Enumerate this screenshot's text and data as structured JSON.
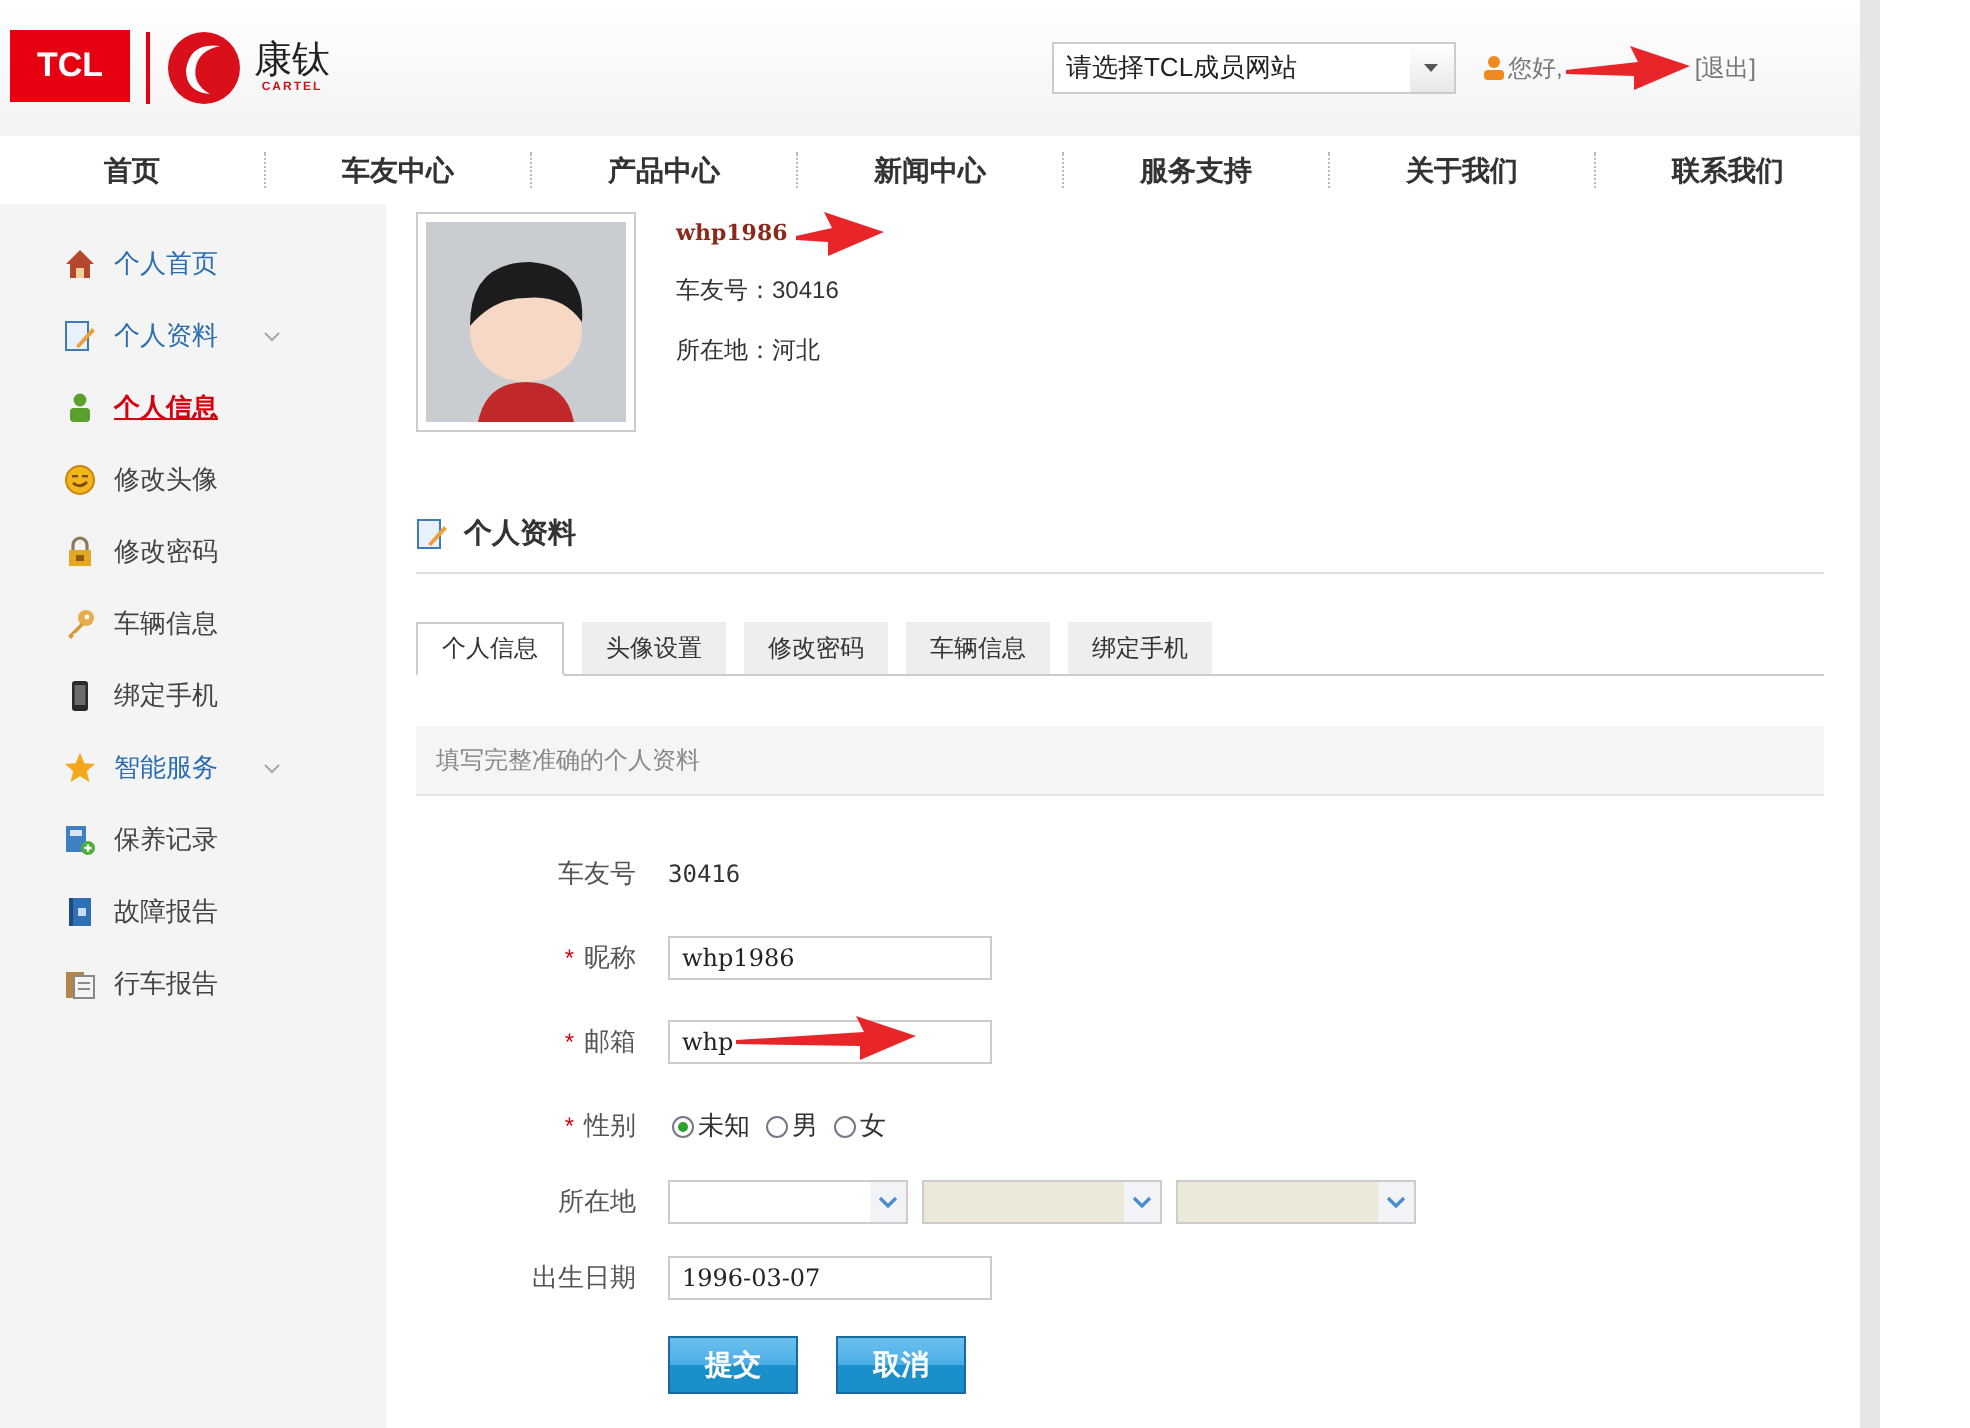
{
  "header": {
    "logo_tcl": "TCL",
    "logo_brand": "康钛",
    "logo_brand_sub": "CARTEL",
    "site_select": {
      "value": "请选择TCL成员网站"
    },
    "greeting": "您好,",
    "logout": "[退出]"
  },
  "nav": [
    "首页",
    "车友中心",
    "产品中心",
    "新闻中心",
    "服务支持",
    "关于我们",
    "联系我们"
  ],
  "sidebar": {
    "items": [
      {
        "label": "个人首页",
        "kind": "link",
        "selected": false
      },
      {
        "label": "个人资料",
        "kind": "group",
        "selected": false
      },
      {
        "label": "个人信息",
        "kind": "item",
        "selected": true
      },
      {
        "label": "修改头像",
        "kind": "item",
        "selected": false
      },
      {
        "label": "修改密码",
        "kind": "item",
        "selected": false
      },
      {
        "label": "车辆信息",
        "kind": "item",
        "selected": false
      },
      {
        "label": "绑定手机",
        "kind": "item",
        "selected": false
      },
      {
        "label": "智能服务",
        "kind": "group",
        "selected": false
      },
      {
        "label": "保养记录",
        "kind": "item",
        "selected": false
      },
      {
        "label": "故障报告",
        "kind": "item",
        "selected": false
      },
      {
        "label": "行车报告",
        "kind": "item",
        "selected": false
      }
    ]
  },
  "profile": {
    "username": "whp1986",
    "member_no": "车友号：30416",
    "location": "所在地：河北"
  },
  "section": {
    "title": "个人资料"
  },
  "tabs": [
    {
      "label": "个人信息",
      "selected": true
    },
    {
      "label": "头像设置",
      "selected": false
    },
    {
      "label": "修改密码",
      "selected": false
    },
    {
      "label": "车辆信息",
      "selected": false
    },
    {
      "label": "绑定手机",
      "selected": false
    }
  ],
  "hint": "填写完整准确的个人资料",
  "form": [
    {
      "kind": "text",
      "label": "车友号",
      "required": false,
      "value": "30416"
    },
    {
      "kind": "input",
      "label": "昵称",
      "required": true,
      "value": "whp1986"
    },
    {
      "kind": "input",
      "label": "邮箱",
      "required": true,
      "value": "whp"
    },
    {
      "kind": "radio",
      "label": "性别",
      "required": true,
      "options": [
        {
          "label": "未知",
          "selected": true
        },
        {
          "label": "男",
          "selected": false
        },
        {
          "label": "女",
          "selected": false
        }
      ]
    },
    {
      "kind": "selects",
      "label": "所在地",
      "required": false,
      "selects": [
        {
          "disabled": false
        },
        {
          "disabled": true
        },
        {
          "disabled": true
        }
      ]
    },
    {
      "kind": "input",
      "label": "出生日期",
      "required": false,
      "value": "1996-03-07"
    }
  ],
  "buttons": [
    "提交",
    "取消"
  ],
  "required_mark": "*"
}
